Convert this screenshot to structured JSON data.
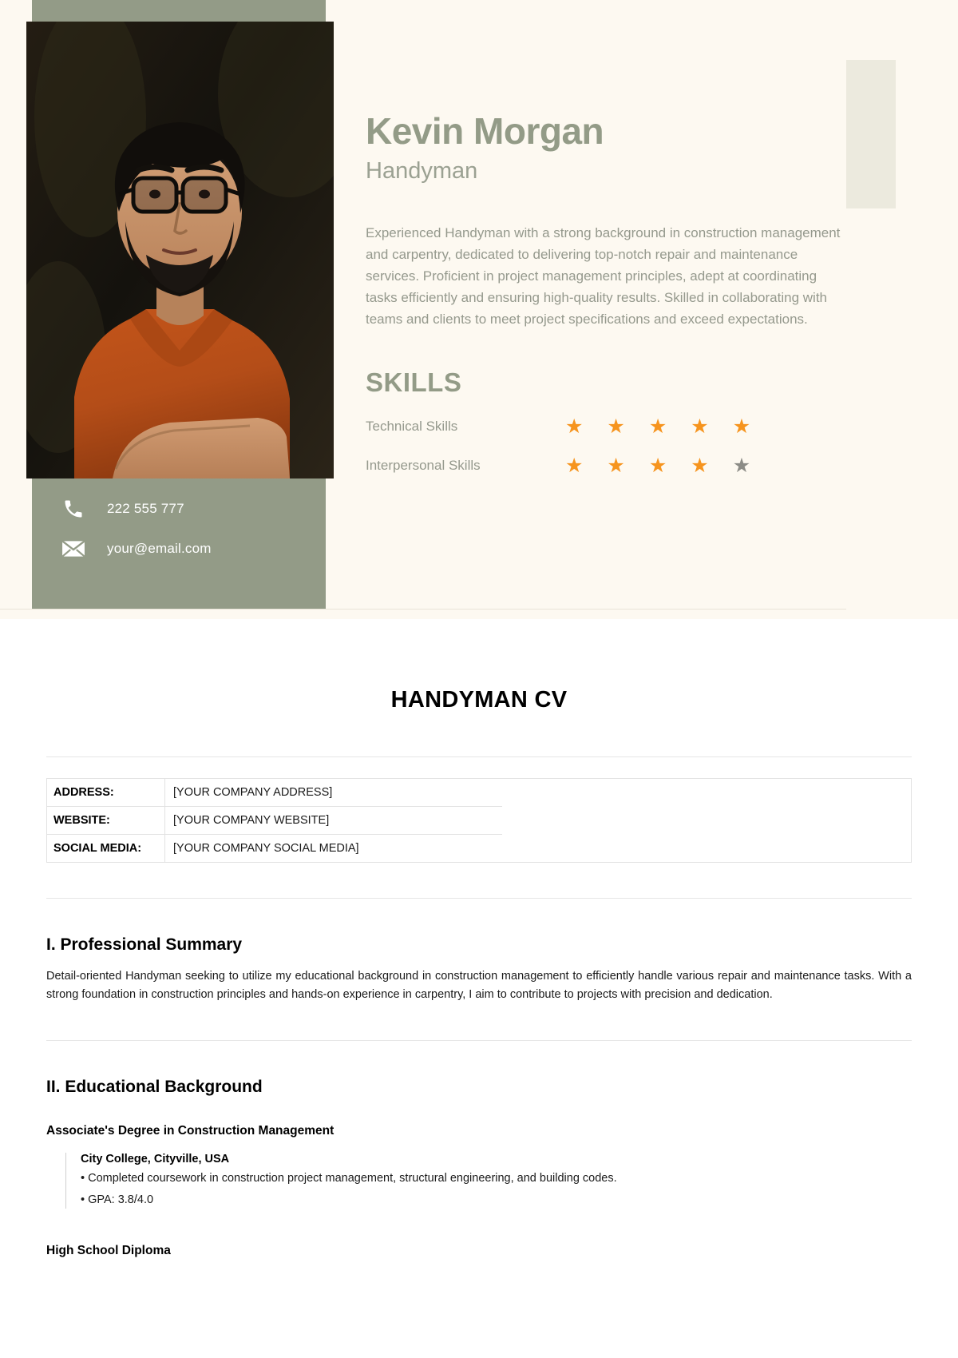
{
  "preview": {
    "name": "Kevin Morgan",
    "role": "Handyman",
    "summary": "Experienced Handyman with a strong background in construction management and carpentry, dedicated to delivering top-notch repair and maintenance services. Proficient in project management principles, adept at coordinating tasks efficiently and ensuring high-quality results. Skilled in collaborating with teams and clients to meet project specifications and exceed expectations.",
    "skills_heading": "SKILLS",
    "skills": [
      {
        "label": "Technical Skills",
        "filled": 5,
        "total": 5
      },
      {
        "label": "Interpersonal Skills",
        "filled": 4,
        "total": 5
      }
    ],
    "contact": [
      {
        "icon": "phone-icon",
        "value": "222 555 777"
      },
      {
        "icon": "envelope-icon",
        "value": "your@email.com"
      }
    ],
    "colors": {
      "sage": "#939b87",
      "cream": "#fdf9f1",
      "star_on": "#f6941e",
      "star_off": "#8c8c87",
      "swatch": "#eceade"
    }
  },
  "document": {
    "title": "HANDYMAN CV",
    "info_rows": [
      {
        "key": "ADDRESS:",
        "value": "[YOUR COMPANY ADDRESS]"
      },
      {
        "key": "WEBSITE:",
        "value": "[YOUR COMPANY WEBSITE]"
      },
      {
        "key": "SOCIAL MEDIA:",
        "value": "[YOUR COMPANY SOCIAL MEDIA]"
      }
    ],
    "section_1": {
      "heading": "I. Professional Summary",
      "body": "Detail-oriented Handyman seeking to utilize my educational background in construction management to efficiently handle various repair and maintenance tasks. With a strong foundation in construction principles and hands-on experience in carpentry, I aim to contribute to projects with precision and dedication."
    },
    "section_2": {
      "heading": "II. Educational Background",
      "entry_1": {
        "degree": "Associate's Degree in Construction Management",
        "school": "City College, Cityville, USA",
        "bullets": [
          "• Completed coursework in construction project management, structural engineering, and building codes.",
          "• GPA: 3.8/4.0"
        ]
      },
      "entry_2": {
        "degree": "High School Diploma"
      }
    }
  }
}
